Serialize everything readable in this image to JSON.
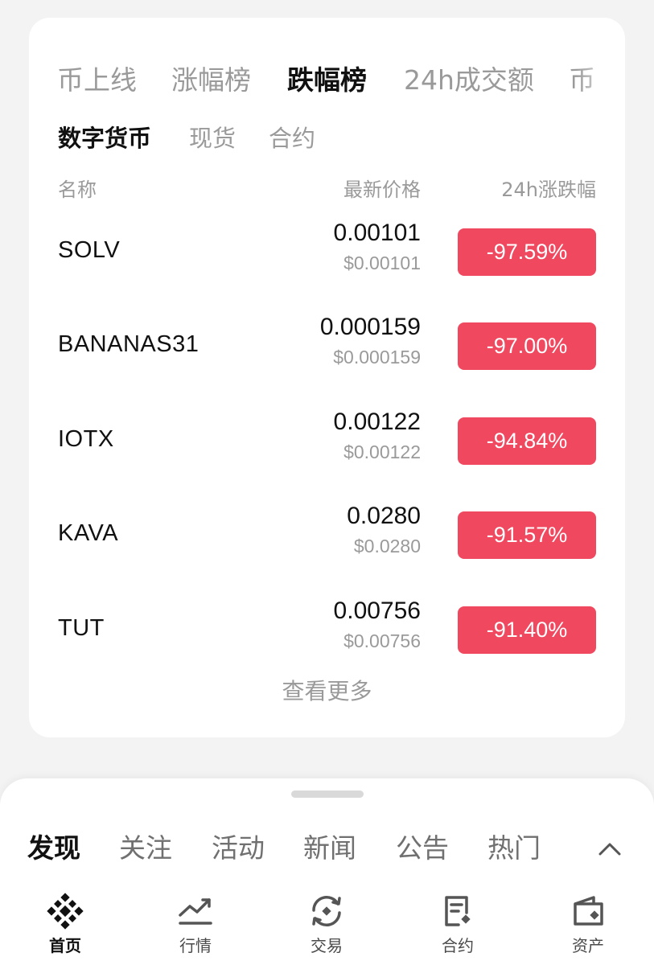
{
  "rank_tabs": [
    {
      "label": "币上线"
    },
    {
      "label": "涨幅榜"
    },
    {
      "label": "跌幅榜",
      "active": true
    },
    {
      "label": "24h成交额"
    },
    {
      "label": "币"
    }
  ],
  "sub_tabs": [
    {
      "label": "数字货币",
      "active": true
    },
    {
      "label": "现货"
    },
    {
      "label": "合约"
    }
  ],
  "columns": {
    "name": "名称",
    "price": "最新价格",
    "change": "24h涨跌幅"
  },
  "rows": [
    {
      "symbol": "SOLV",
      "price": "0.00101",
      "usd": "$0.00101",
      "change": "-97.59%"
    },
    {
      "symbol": "BANANAS31",
      "price": "0.000159",
      "usd": "$0.000159",
      "change": "-97.00%"
    },
    {
      "symbol": "IOTX",
      "price": "0.00122",
      "usd": "$0.00122",
      "change": "-94.84%"
    },
    {
      "symbol": "KAVA",
      "price": "0.0280",
      "usd": "$0.0280",
      "change": "-91.57%"
    },
    {
      "symbol": "TUT",
      "price": "0.00756",
      "usd": "$0.00756",
      "change": "-91.40%"
    }
  ],
  "view_more": "查看更多",
  "feed_tabs": [
    {
      "label": "发现",
      "active": true
    },
    {
      "label": "关注"
    },
    {
      "label": "活动"
    },
    {
      "label": "新闻"
    },
    {
      "label": "公告"
    },
    {
      "label": "热门"
    }
  ],
  "bottom_nav": [
    {
      "label": "首页",
      "icon": "home-diamond-icon",
      "active": true
    },
    {
      "label": "行情",
      "icon": "market-chart-icon"
    },
    {
      "label": "交易",
      "icon": "trade-swap-icon"
    },
    {
      "label": "合约",
      "icon": "futures-doc-icon"
    },
    {
      "label": "资产",
      "icon": "wallet-icon"
    }
  ],
  "colors": {
    "negative": "#f0485f",
    "text_primary": "#111111",
    "text_secondary": "#9a9a9a",
    "background": "#f3f3f3"
  }
}
